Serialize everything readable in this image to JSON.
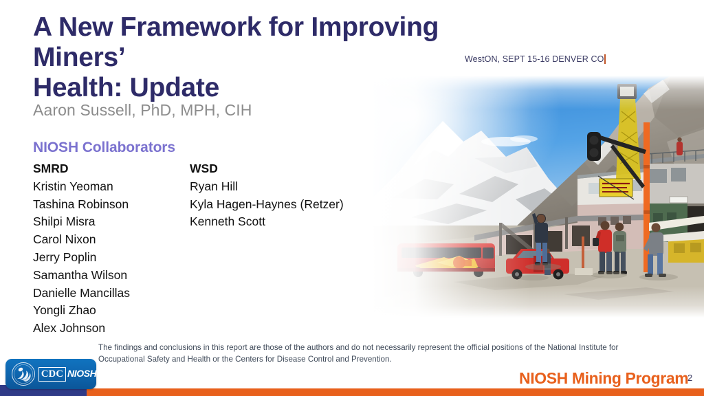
{
  "slide": {
    "title": "A New Framework for Improving Miners’\nHealth: Update",
    "conference": "WestON, SEPT 15-16 DENVER CO",
    "author": "Aaron Sussell, PhD, MPH, CIH",
    "collaborators_heading": "NIOSH Collaborators",
    "collaborator_groups": [
      {
        "name": "SMRD",
        "members": [
          "Kristin Yeoman",
          "Tashina Robinson",
          "Shilpi Misra",
          "Carol Nixon",
          "Jerry Poplin",
          "Samantha Wilson",
          "Danielle Mancillas",
          "Yongli Zhao",
          "Alex Johnson"
        ]
      },
      {
        "name": "WSD",
        "members": [
          "Ryan Hill",
          "Kyla Hagen-Haynes (Retzer)",
          "Kenneth Scott"
        ]
      }
    ],
    "disclaimer": "The findings and conclusions in this report are those of the authors and do not necessarily represent the official positions of the National Institute for Occupational Safety and Health or the Centers for Disease Control and Prevention.",
    "photo_alt": "High-altitude mine site with snow-capped mountains, a red bus, a red pickup truck, industrial buildings and workers walking",
    "footer": {
      "logo_cdc": "CDC",
      "logo_niosh": "NIOSH",
      "mining_program": "NIOSH Mining Program",
      "page_number": "2"
    },
    "colors": {
      "title_navy": "#2e2b68",
      "collaborators_purple": "#7b72cf",
      "author_gray": "#8c8c8c",
      "accent_orange": "#e8601c",
      "bar_navy": "#2f3a87",
      "logo_blue": "#0e64ad",
      "disclaimer_gray": "#404b5a"
    }
  }
}
